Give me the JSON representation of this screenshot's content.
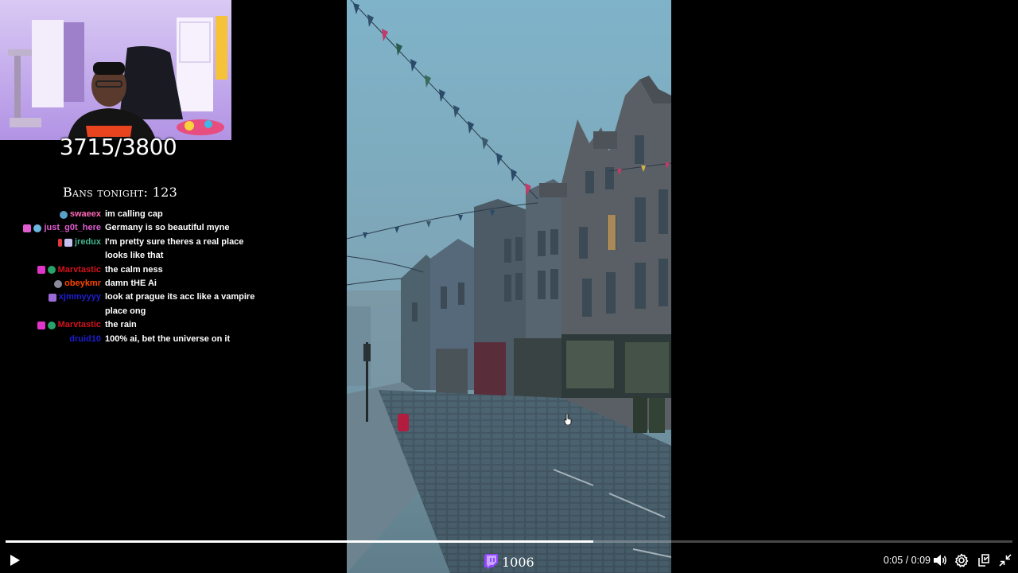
{
  "overlay": {
    "goal_counter": "3715/3800",
    "bans_tonight": "Bans tonight: 123",
    "viewer_count": "1006"
  },
  "chat": {
    "messages": [
      {
        "user": "swaeex",
        "color": "#ff69b4",
        "text": "im calling cap"
      },
      {
        "user": "just_g0t_here",
        "color": "#e05cd0",
        "text": "Germany is so beautiful myne"
      },
      {
        "user": "jredux",
        "color": "#3fb58f",
        "text": "I'm pretty sure theres a real place looks like that"
      },
      {
        "user": "Marvtastic",
        "color": "#d4121c",
        "text": "the calm ness"
      },
      {
        "user": "obeykmr",
        "color": "#ff4500",
        "text": "damn tHE Ai"
      },
      {
        "user": "xjmmyyyy",
        "color": "#1e1ed6",
        "text": "look at prague its acc like a vampire place ong"
      },
      {
        "user": "Marvtastic",
        "color": "#d4121c",
        "text": "the rain"
      },
      {
        "user": "druid10",
        "color": "#1e1ed6",
        "text": "100% ai, bet the universe on it"
      }
    ]
  },
  "player": {
    "time_display": "0:05 / 0:09",
    "progress_fraction": 0.584,
    "controls": [
      "play-icon",
      "volume-icon",
      "settings-icon",
      "miniplayer-icon",
      "exit-fullscreen-icon"
    ]
  },
  "colors": {
    "background": "#000000",
    "progress_fill": "#ffffff",
    "progress_track": "#4a4a4a",
    "twitch_purple": "#9146ff"
  }
}
